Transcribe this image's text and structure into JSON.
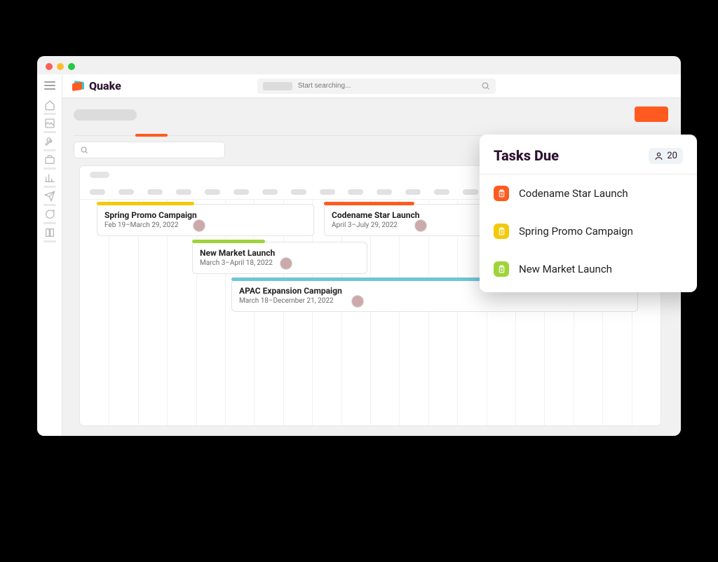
{
  "app": {
    "name": "Quake"
  },
  "search": {
    "placeholder": "Start searching..."
  },
  "header": {
    "cta_color": "#ff5a1f"
  },
  "timeline": {
    "tasks": [
      {
        "title": "Spring Promo Campaign",
        "dates": "Feb 19–March 29, 2022",
        "color": "yellow"
      },
      {
        "title": "Codename Star Launch",
        "dates": "April 3–July 29, 2022",
        "color": "orange"
      },
      {
        "title": "New Market Launch",
        "dates": "March 3–April 18, 2022",
        "color": "green"
      },
      {
        "title": "APAC Expansion Campaign",
        "dates": "March 18–December 21, 2022",
        "color": "teal"
      }
    ]
  },
  "tasks_due": {
    "title": "Tasks Due",
    "count": "20",
    "items": [
      {
        "label": "Codename Star Launch",
        "chip": "orange"
      },
      {
        "label": "Spring Promo Campaign",
        "chip": "yellow"
      },
      {
        "label": "New Market Launch",
        "chip": "green"
      }
    ]
  }
}
